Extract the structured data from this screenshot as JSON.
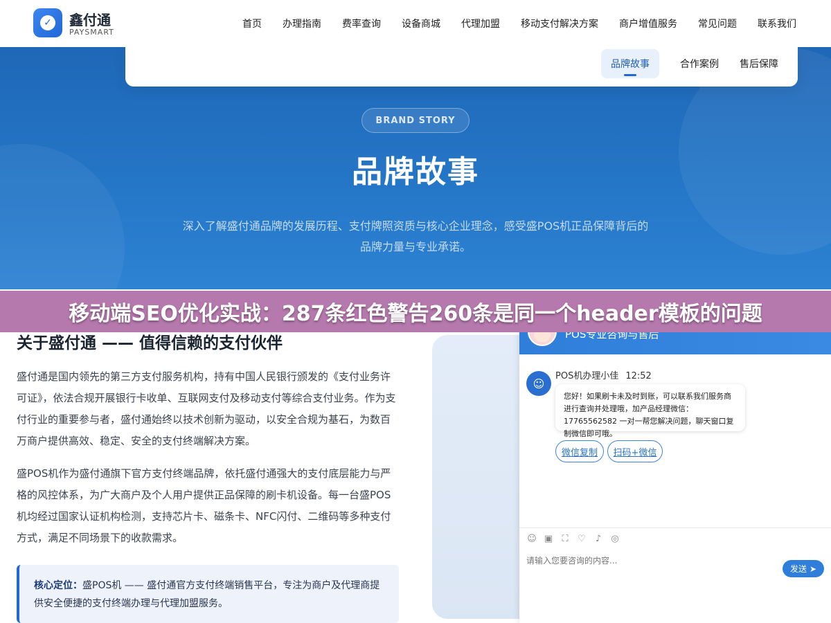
{
  "logo": {
    "name": "鑫付通",
    "sub": "PAYSMART"
  },
  "nav": {
    "row1": [
      "首页",
      "办理指南",
      "费率查询",
      "设备商城",
      "代理加盟",
      "移动支付解决方案",
      "商户增值服务",
      "常见问题",
      "联系我们"
    ],
    "row2": [
      "品牌故事",
      "合作案例",
      "售后保障"
    ]
  },
  "banner": {
    "pill": "BRAND STORY",
    "title": "品牌故事",
    "desc": "深入了解盛付通品牌的发展历程、支付牌照资质与核心企业理念，感受盛POS机正品保障背后的品牌力量与专业承诺。"
  },
  "overlay": {
    "text": "移动端SEO优化实战：287条红色警告260条是同一个header模板的问题"
  },
  "about": {
    "title": "关于盛付通 —— 值得信赖的支付伙伴",
    "para1": "盛付通是国内领先的第三方支付服务机构，持有中国人民银行颁发的《支付业务许可证》，依法合规开展银行卡收单、互联网支付及移动支付等综合支付业务。作为支付行业的重要参与者，盛付通始终以技术创新为驱动，以安全合规为基石，为数百万商户提供高效、稳定、安全的支付终端解决方案。",
    "para2": "盛POS机作为盛付通旗下官方支付终端品牌，依托盛付通强大的支付底层能力与严格的风控体系，为广大商户及个人用户提供正品保障的刷卡机设备。每一台盛POS机均经过国家认证机构检测，支持芯片卡、磁条卡、NFC闪付、二维码等多种支付方式，满足不同场景下的收款需求。",
    "core_label": "核心定位：",
    "core_text": "盛POS机 —— 盛付通官方支付终端销售平台，专注为商户及代理商提供安全便捷的支付终端办理与代理加盟服务。"
  },
  "chat": {
    "title": "POS专业咨询与售后",
    "sender": "POS机办理小佳",
    "time": "12:52",
    "message": "您好！如果刷卡未及时到账，可以联系我们服务商进行查询并处理哦，加产品经理微信：17765562582 一对一帮您解决问题，聊天窗口复制微信即可哦。",
    "chip1": "微信复制",
    "chip2": "扫码+微信",
    "placeholder": "请输入您要咨询的内容...",
    "send": "发送"
  },
  "colors": {
    "brand_blue": "#2167d8",
    "overlay": "#b679ad",
    "chat_blue": "#2f7ed9"
  },
  "icons": [
    "check-icon",
    "emoji-icon",
    "image-icon",
    "screenshot-icon",
    "evaluate-icon",
    "mute-icon",
    "transfer-icon",
    "send-arrow-icon"
  ]
}
